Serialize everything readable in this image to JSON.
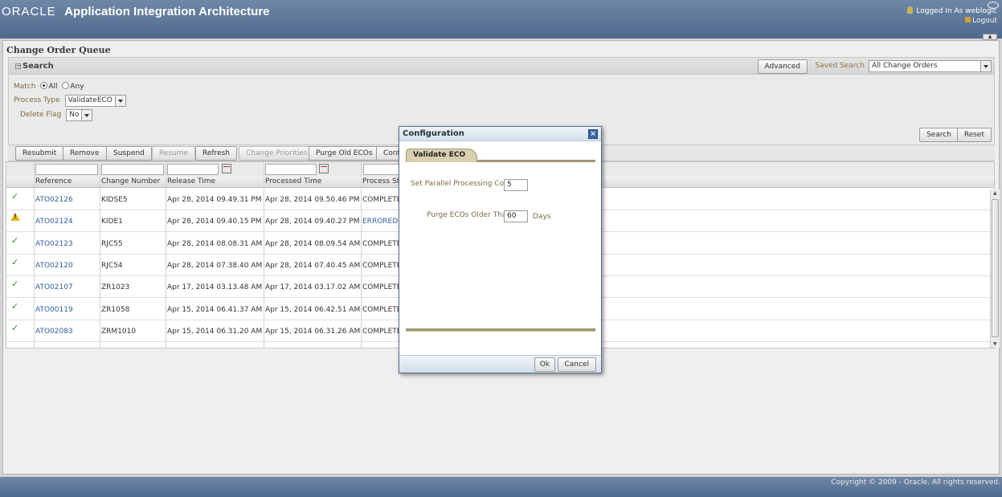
{
  "header": {
    "brand": "ORACLE",
    "app_title": "Application Integration Architecture",
    "logged_in": "Logged In As  weblogic",
    "logout": "Logout"
  },
  "page": {
    "title": "Change Order Queue"
  },
  "search": {
    "title": "Search",
    "advanced": "Advanced",
    "saved_search_label": "Saved Search",
    "saved_search_value": "All Change Orders",
    "match_label": "Match",
    "match_all": "All",
    "match_any": "Any",
    "process_type_label": "Process Type",
    "process_type_value": "ValidateECO",
    "delete_flag_label": "Delete Flag",
    "delete_flag_value": "No",
    "search_btn": "Search",
    "reset_btn": "Reset"
  },
  "toolbar": {
    "resubmit": "Resubmit",
    "remove": "Remove",
    "suspend": "Suspend",
    "resume": "Resume",
    "refresh": "Refresh",
    "change_priorities": "Change Priorities",
    "purge": "Purge Old ECOs",
    "config": "Confi"
  },
  "table": {
    "headers": [
      "Reference",
      "Change Number",
      "Release Time",
      "Processed Time",
      "Process Stat"
    ],
    "rows": [
      {
        "status": "ok",
        "ref": "ATO02126",
        "change": "KIDSE5",
        "release": "Apr 28, 2014 09.49.31 PM",
        "processed": "Apr 28, 2014 09.50.46 PM",
        "pstatus": "COMPLETED"
      },
      {
        "status": "warn",
        "ref": "ATO02124",
        "change": "KIDE1",
        "release": "Apr 28, 2014 09.40.15 PM",
        "processed": "Apr 28, 2014 09.40.27 PM",
        "pstatus": "ERRORED"
      },
      {
        "status": "ok",
        "ref": "ATO02123",
        "change": "RJC55",
        "release": "Apr 28, 2014 08.08.31 AM",
        "processed": "Apr 28, 2014 08.09.54 AM",
        "pstatus": "COMPLETED"
      },
      {
        "status": "ok",
        "ref": "ATO02120",
        "change": "RJC54",
        "release": "Apr 28, 2014 07.38.40 AM",
        "processed": "Apr 28, 2014 07.40.45 AM",
        "pstatus": "COMPLETED"
      },
      {
        "status": "ok",
        "ref": "ATO02107",
        "change": "ZR1023",
        "release": "Apr 17, 2014 03.13.48 AM",
        "processed": "Apr 17, 2014 03.17.02 AM",
        "pstatus": "COMPLETED"
      },
      {
        "status": "ok",
        "ref": "ATO00119",
        "change": "ZR1058",
        "release": "Apr 15, 2014 06.41.37 AM",
        "processed": "Apr 15, 2014 06.42.51 AM",
        "pstatus": "COMPLETED"
      },
      {
        "status": "ok",
        "ref": "ATO02083",
        "change": "ZRM1010",
        "release": "Apr 15, 2014 06.31.20 AM",
        "processed": "Apr 15, 2014 06.31.26 AM",
        "pstatus": "COMPLETED"
      }
    ]
  },
  "modal": {
    "title": "Configuration",
    "tab": "Validate ECO",
    "parallel_label": "Set Parallel Processing Count",
    "parallel_value": "5",
    "purge_label": "Purge ECOs Older Than",
    "purge_value": "60",
    "days": "Days",
    "ok": "Ok",
    "cancel": "Cancel"
  },
  "footer": {
    "copyright": "Copyright © 2009 - Oracle. All rights reserved."
  },
  "colors": {
    "header_blue": "#4e6a8e",
    "link": "#2f5f9d",
    "ok_green": "#3a8a2e",
    "label_olive": "#7b6d40"
  }
}
